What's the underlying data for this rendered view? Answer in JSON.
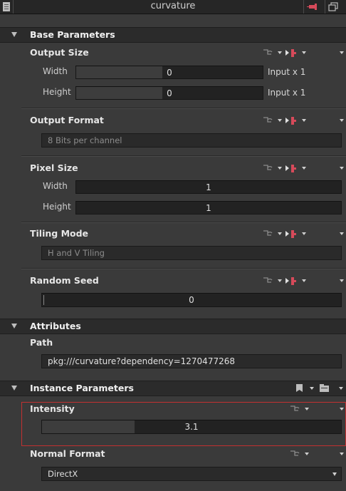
{
  "window": {
    "title": "curvature"
  },
  "icons": {
    "doc": "document-icon",
    "pin": "pin-icon",
    "restore": "restore-window-icon",
    "expand": "expand-triangle-icon",
    "function": "function-graph-icon",
    "dropdown": "dropdown-arrow-icon",
    "play_flag": "play-flag-icon",
    "bookmark": "bookmark-icon",
    "folder": "folder-icon"
  },
  "colors": {
    "accent_red": "#c23030",
    "pin_red": "#d64a5a"
  },
  "sections": {
    "base": {
      "label": "Base Parameters"
    },
    "attributes": {
      "label": "Attributes"
    },
    "instance": {
      "label": "Instance Parameters"
    }
  },
  "output_size": {
    "label": "Output Size",
    "width_label": "Width",
    "width_value": "0",
    "width_suffix": "Input x 1",
    "height_label": "Height",
    "height_value": "0",
    "height_suffix": "Input x 1"
  },
  "output_format": {
    "label": "Output Format",
    "value": "8 Bits per channel"
  },
  "pixel_size": {
    "label": "Pixel Size",
    "width_label": "Width",
    "width_value": "1",
    "height_label": "Height",
    "height_value": "1"
  },
  "tiling_mode": {
    "label": "Tiling Mode",
    "value": "H and V Tiling"
  },
  "random_seed": {
    "label": "Random Seed",
    "value": "0"
  },
  "path": {
    "label": "Path",
    "value": "pkg:///curvature?dependency=1270477268"
  },
  "intensity": {
    "label": "Intensity",
    "value": "3.1",
    "fill_fraction": 0.31
  },
  "normal_format": {
    "label": "Normal Format",
    "value": "DirectX"
  }
}
